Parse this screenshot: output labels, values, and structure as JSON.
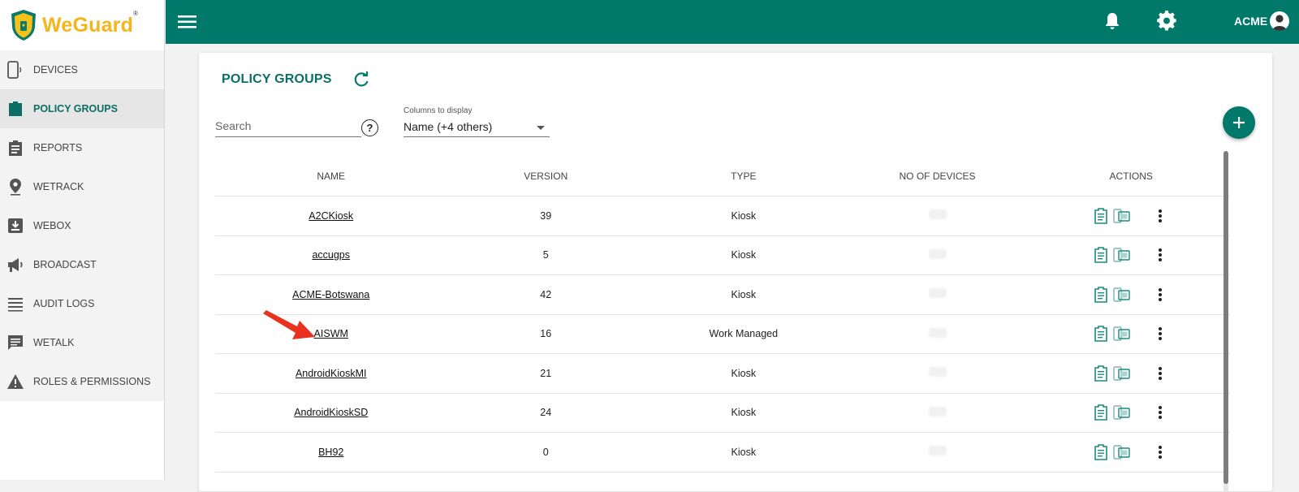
{
  "brand": {
    "name_part1": "We",
    "name_part2": "Guard",
    "reg": "®"
  },
  "sidebar": {
    "items": [
      {
        "label": "DEVICES",
        "icon": "phone-icon",
        "active": false
      },
      {
        "label": "POLICY GROUPS",
        "icon": "badge-icon",
        "active": true
      },
      {
        "label": "REPORTS",
        "icon": "clipboard-icon",
        "active": false
      },
      {
        "label": "WETRACK",
        "icon": "location-pin-icon",
        "active": false
      },
      {
        "label": "WEBOX",
        "icon": "download-box-icon",
        "active": false
      },
      {
        "label": "BROADCAST",
        "icon": "megaphone-icon",
        "active": false
      },
      {
        "label": "AUDIT LOGS",
        "icon": "list-icon",
        "active": false
      },
      {
        "label": "WETALK",
        "icon": "chat-icon",
        "active": false
      },
      {
        "label": "ROLES & PERMISSIONS",
        "icon": "warning-icon",
        "active": false
      }
    ]
  },
  "topbar": {
    "account_name": "ACME"
  },
  "page": {
    "title": "POLICY GROUPS",
    "search_placeholder": "Search",
    "help_label": "?",
    "columns_label": "Columns to display",
    "columns_value": "Name (+4 others)"
  },
  "table": {
    "headers": {
      "name": "NAME",
      "version": "VERSION",
      "type": "TYPE",
      "devices": "NO OF DEVICES",
      "actions": "ACTIONS"
    },
    "rows": [
      {
        "name": "A2CKiosk",
        "version": "39",
        "type": "Kiosk"
      },
      {
        "name": "accugps",
        "version": "5",
        "type": "Kiosk"
      },
      {
        "name": "ACME-Botswana",
        "version": "42",
        "type": "Kiosk"
      },
      {
        "name": "AISWM",
        "version": "16",
        "type": "Work Managed"
      },
      {
        "name": "AndroidKioskMI",
        "version": "21",
        "type": "Kiosk"
      },
      {
        "name": "AndroidKioskSD",
        "version": "24",
        "type": "Kiosk"
      },
      {
        "name": "BH92",
        "version": "0",
        "type": "Kiosk"
      }
    ]
  },
  "colors": {
    "primary": "#00796b",
    "accent": "#f4b41a",
    "annotation_arrow": "#e8321f"
  }
}
